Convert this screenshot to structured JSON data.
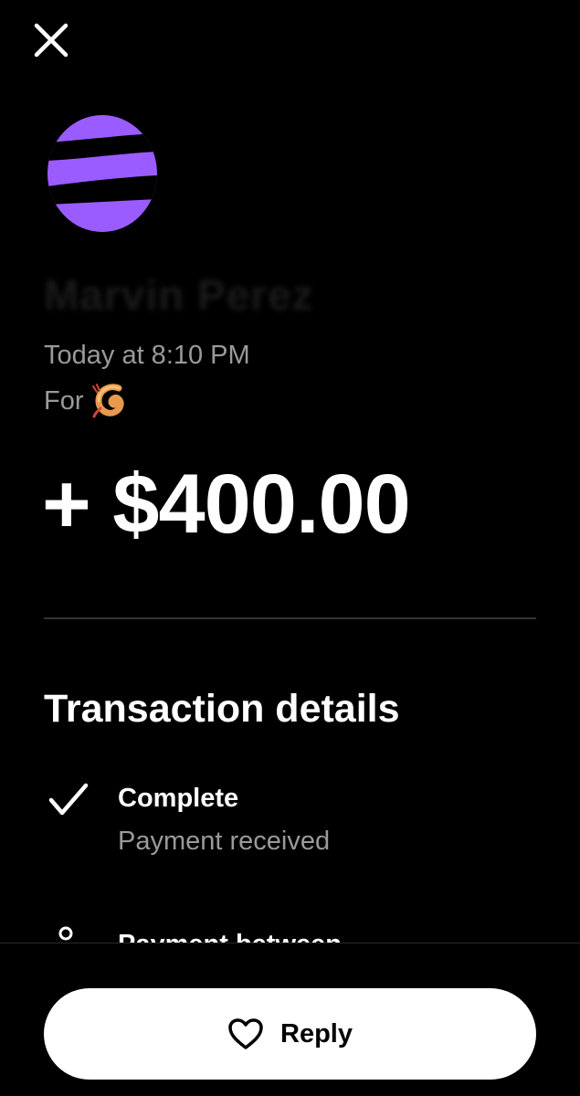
{
  "header": {
    "close_icon": "close-icon"
  },
  "transaction": {
    "avatar_color": "#9b5cff",
    "name": "Marvin Perez",
    "timestamp": "Today at 8:10 PM",
    "for_label": "For",
    "for_icon": "shrimp-icon",
    "amount": "+ $400.00"
  },
  "details": {
    "title": "Transaction details",
    "status": {
      "icon": "check-icon",
      "title": "Complete",
      "subtitle": "Payment received"
    },
    "payment_between": {
      "icon": "person-icon",
      "title": "Payment between"
    }
  },
  "footer": {
    "reply_label": "Reply",
    "reply_icon": "heart-icon"
  },
  "colors": {
    "background": "#000000",
    "text_primary": "#ffffff",
    "text_secondary": "#9a9a9a",
    "accent": "#9b5cff",
    "button_bg": "#ffffff"
  }
}
